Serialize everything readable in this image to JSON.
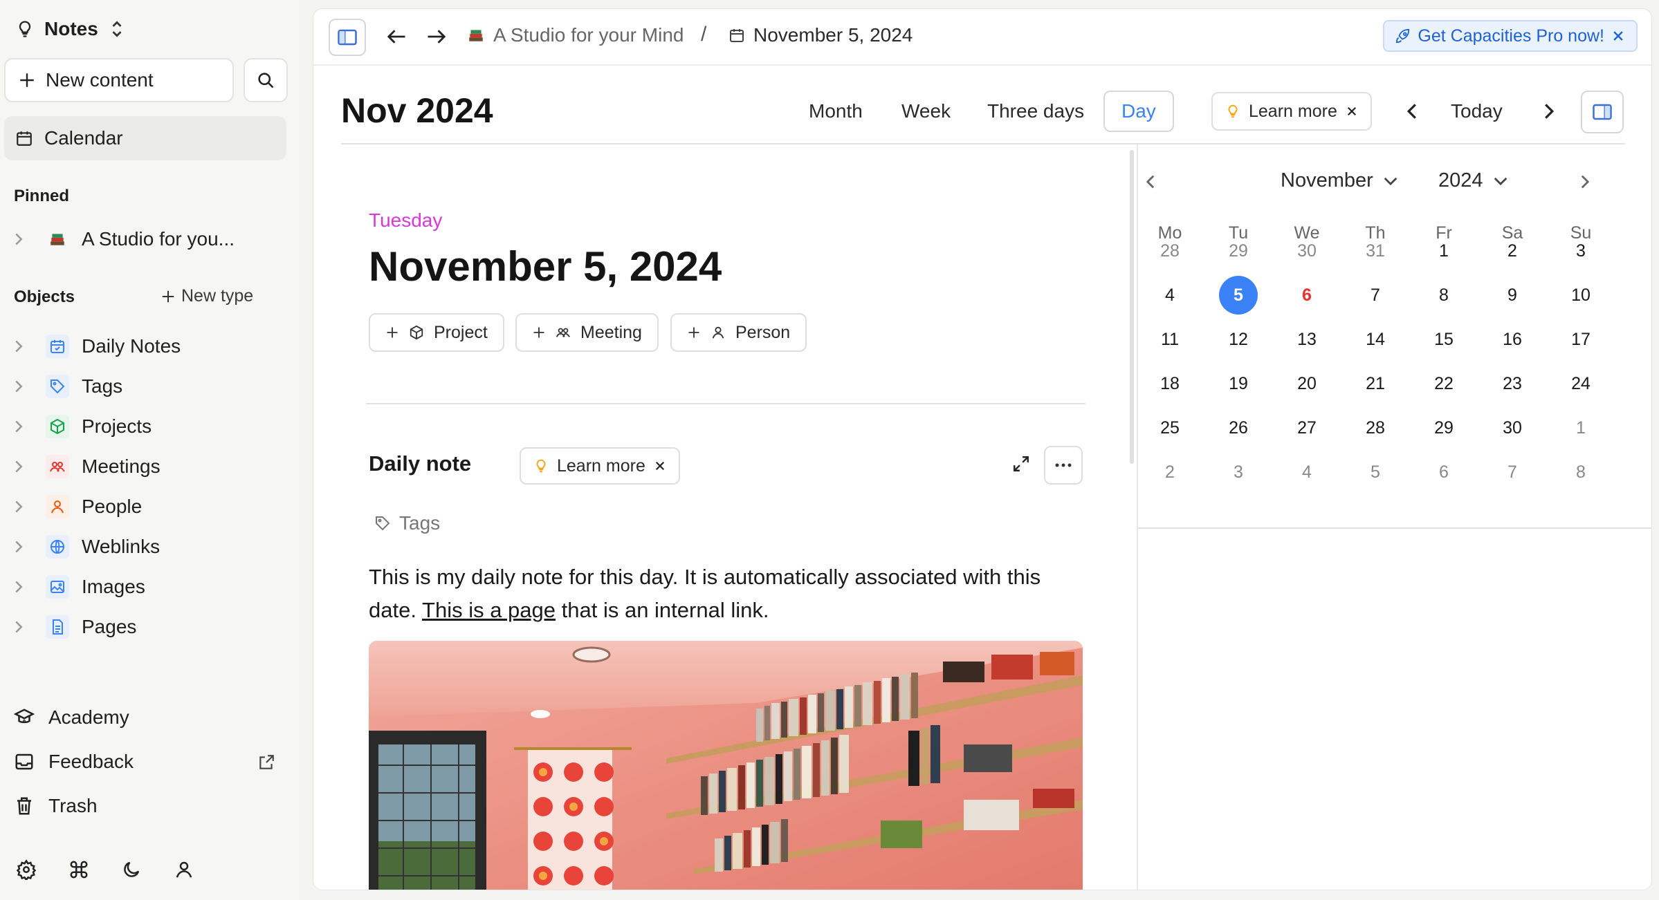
{
  "sidebar": {
    "workspace": "Notes",
    "new_content": "New content",
    "calendar": "Calendar",
    "pinned_label": "Pinned",
    "pinned_items": [
      {
        "label": "A Studio for you..."
      }
    ],
    "objects_label": "Objects",
    "new_type": "New type",
    "objects": [
      {
        "label": "Daily Notes",
        "icon": "calendar-check-icon",
        "color": "#3b82f6"
      },
      {
        "label": "Tags",
        "icon": "tag-icon",
        "color": "#3b82f6"
      },
      {
        "label": "Projects",
        "icon": "cube-icon",
        "color": "#16a34a"
      },
      {
        "label": "Meetings",
        "icon": "people-icon",
        "color": "#e5322d"
      },
      {
        "label": "People",
        "icon": "person-icon",
        "color": "#ea580c"
      },
      {
        "label": "Weblinks",
        "icon": "globe-icon",
        "color": "#3b82f6"
      },
      {
        "label": "Images",
        "icon": "image-icon",
        "color": "#3b82f6"
      },
      {
        "label": "Pages",
        "icon": "page-icon",
        "color": "#3b82f6"
      }
    ],
    "bottom": {
      "academy": "Academy",
      "feedback": "Feedback",
      "trash": "Trash"
    }
  },
  "topbar": {
    "breadcrumb_space": "A Studio for your Mind",
    "breadcrumb_sep": "/",
    "breadcrumb_current": "November 5, 2024",
    "promo": "Get Capacities Pro now!"
  },
  "calendar": {
    "title": "Nov 2024",
    "views": [
      "Month",
      "Week",
      "Three days",
      "Day"
    ],
    "active_view": "Day",
    "learn_more": "Learn more",
    "today": "Today"
  },
  "day": {
    "weekday": "Tuesday",
    "date_title": "November 5, 2024",
    "object_buttons": [
      "Project",
      "Meeting",
      "Person"
    ],
    "daily_note_label": "Daily note",
    "learn_more": "Learn more",
    "tags_label": "Tags",
    "text_before": "This is my daily note for this day. It is automatically associated with this date. ",
    "link_text": "This is a page",
    "text_after": " that is an internal link."
  },
  "minical": {
    "month": "November",
    "year": "2024",
    "weekdays": [
      "Mo",
      "Tu",
      "We",
      "Th",
      "Fr",
      "Sa",
      "Su"
    ],
    "weeks": [
      [
        "28",
        "29",
        "30",
        "31",
        "1",
        "2",
        "3"
      ],
      [
        "4",
        "5",
        "6",
        "7",
        "8",
        "9",
        "10"
      ],
      [
        "11",
        "12",
        "13",
        "14",
        "15",
        "16",
        "17"
      ],
      [
        "18",
        "19",
        "20",
        "21",
        "22",
        "23",
        "24"
      ],
      [
        "25",
        "26",
        "27",
        "28",
        "29",
        "30",
        "1"
      ],
      [
        "2",
        "3",
        "4",
        "5",
        "6",
        "7",
        "8"
      ]
    ],
    "selected": "5",
    "highlighted": "6",
    "accent": "#3b82f6",
    "highlight_color": "#e5322d"
  }
}
